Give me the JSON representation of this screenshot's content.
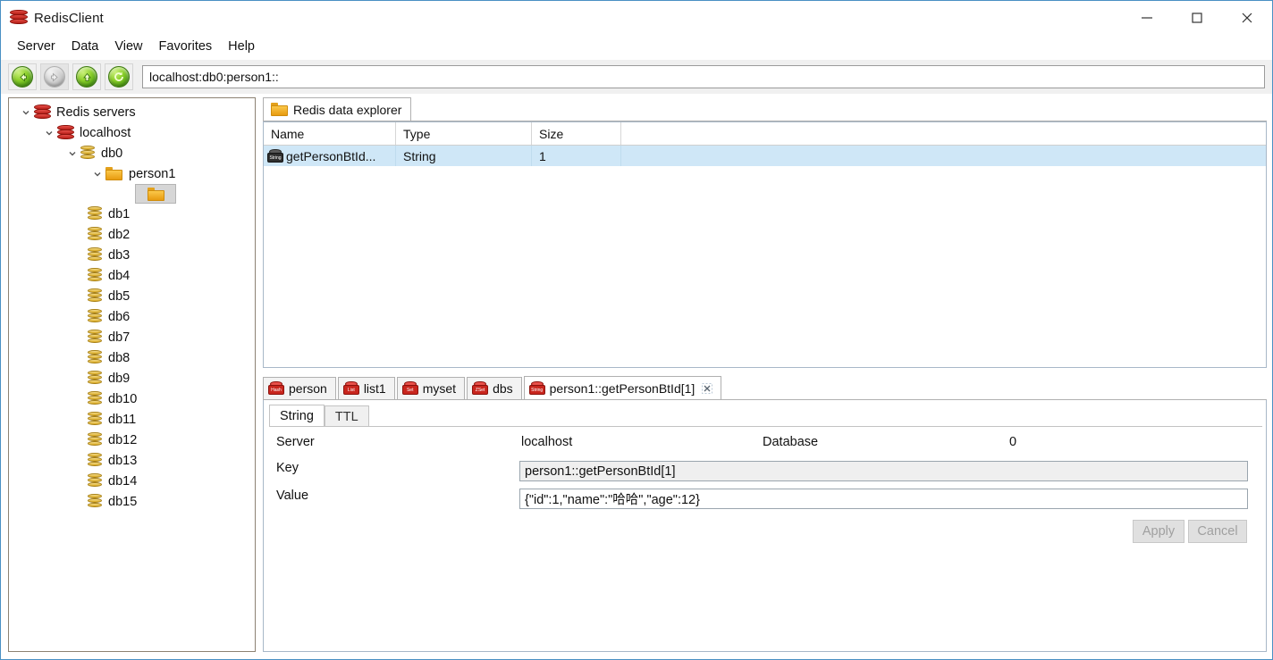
{
  "window": {
    "title": "RedisClient",
    "app_icon": "redis-stack-icon",
    "controls": {
      "minimize": "minimize-icon",
      "maximize": "maximize-icon",
      "close": "close-icon"
    },
    "border_color": "#4a90c4"
  },
  "menubar": {
    "items": [
      {
        "label": "Server"
      },
      {
        "label": "Data"
      },
      {
        "label": "View"
      },
      {
        "label": "Favorites"
      },
      {
        "label": "Help"
      }
    ]
  },
  "toolbar": {
    "buttons": [
      {
        "name": "back-button",
        "icon": "arrow-left-icon",
        "enabled": true
      },
      {
        "name": "forward-button",
        "icon": "arrow-right-icon",
        "enabled": false
      },
      {
        "name": "up-button",
        "icon": "arrow-up-icon",
        "enabled": true
      },
      {
        "name": "refresh-button",
        "icon": "refresh-icon",
        "enabled": true
      }
    ],
    "address": {
      "value": "localhost:db0:person1::",
      "placeholder": ""
    }
  },
  "tree": {
    "nodes": [
      {
        "label": "Redis servers",
        "icon": "redis-icon",
        "indent": 0,
        "expander": "chevron-down-icon",
        "selected": false
      },
      {
        "label": "localhost",
        "icon": "redis-icon",
        "indent": 1,
        "expander": "chevron-down-icon",
        "selected": false
      },
      {
        "label": "db0",
        "icon": "database-icon",
        "indent": 2,
        "expander": "chevron-down-icon",
        "selected": false
      },
      {
        "label": "person1",
        "icon": "folder-icon",
        "indent": 3,
        "expander": "chevron-down-icon",
        "selected": false
      },
      {
        "label": "",
        "icon": "folder-icon",
        "indent": 4,
        "expander": "none",
        "selected": true
      },
      {
        "label": "db1",
        "icon": "database-icon",
        "indent": 2,
        "expander": "none",
        "selected": false
      },
      {
        "label": "db2",
        "icon": "database-icon",
        "indent": 2,
        "expander": "none",
        "selected": false
      },
      {
        "label": "db3",
        "icon": "database-icon",
        "indent": 2,
        "expander": "none",
        "selected": false
      },
      {
        "label": "db4",
        "icon": "database-icon",
        "indent": 2,
        "expander": "none",
        "selected": false
      },
      {
        "label": "db5",
        "icon": "database-icon",
        "indent": 2,
        "expander": "none",
        "selected": false
      },
      {
        "label": "db6",
        "icon": "database-icon",
        "indent": 2,
        "expander": "none",
        "selected": false
      },
      {
        "label": "db7",
        "icon": "database-icon",
        "indent": 2,
        "expander": "none",
        "selected": false
      },
      {
        "label": "db8",
        "icon": "database-icon",
        "indent": 2,
        "expander": "none",
        "selected": false
      },
      {
        "label": "db9",
        "icon": "database-icon",
        "indent": 2,
        "expander": "none",
        "selected": false
      },
      {
        "label": "db10",
        "icon": "database-icon",
        "indent": 2,
        "expander": "none",
        "selected": false
      },
      {
        "label": "db11",
        "icon": "database-icon",
        "indent": 2,
        "expander": "none",
        "selected": false
      },
      {
        "label": "db12",
        "icon": "database-icon",
        "indent": 2,
        "expander": "none",
        "selected": false
      },
      {
        "label": "db13",
        "icon": "database-icon",
        "indent": 2,
        "expander": "none",
        "selected": false
      },
      {
        "label": "db14",
        "icon": "database-icon",
        "indent": 2,
        "expander": "none",
        "selected": false
      },
      {
        "label": "db15",
        "icon": "database-icon",
        "indent": 2,
        "expander": "none",
        "selected": false
      }
    ]
  },
  "explorer": {
    "tab_label": "Redis data explorer",
    "tab_icon": "folder-icon",
    "columns": [
      {
        "label": "Name",
        "width": 148
      },
      {
        "label": "Type",
        "width": 152
      },
      {
        "label": "Size",
        "width": 100
      }
    ],
    "rows": [
      {
        "name": "getPersonBtId...",
        "type": "String",
        "size": "1",
        "icon": "string-type-icon",
        "selected": true
      }
    ],
    "selection_color": "#cfe7f7"
  },
  "key_tabs": {
    "items": [
      {
        "label": "person",
        "type": "Hash",
        "active": false,
        "closable": false
      },
      {
        "label": "list1",
        "type": "List",
        "active": false,
        "closable": false
      },
      {
        "label": "myset",
        "type": "Set",
        "active": false,
        "closable": false
      },
      {
        "label": "dbs",
        "type": "ZSet",
        "active": false,
        "closable": false
      },
      {
        "label": "person1::getPersonBtId[1]",
        "type": "String",
        "active": true,
        "closable": true
      }
    ],
    "close_icon": "close-icon"
  },
  "editor": {
    "subtabs": [
      {
        "label": "String",
        "active": true
      },
      {
        "label": "TTL",
        "active": false
      }
    ],
    "fields": {
      "server_label": "Server",
      "server_value": "localhost",
      "database_label": "Database",
      "database_value": "0",
      "key_label": "Key",
      "key_value": "person1::getPersonBtId[1]",
      "value_label": "Value",
      "value_value": "{\"id\":1,\"name\":\"哈哈\",\"age\":12}"
    },
    "buttons": {
      "apply": "Apply",
      "cancel": "Cancel",
      "enabled": false
    }
  }
}
